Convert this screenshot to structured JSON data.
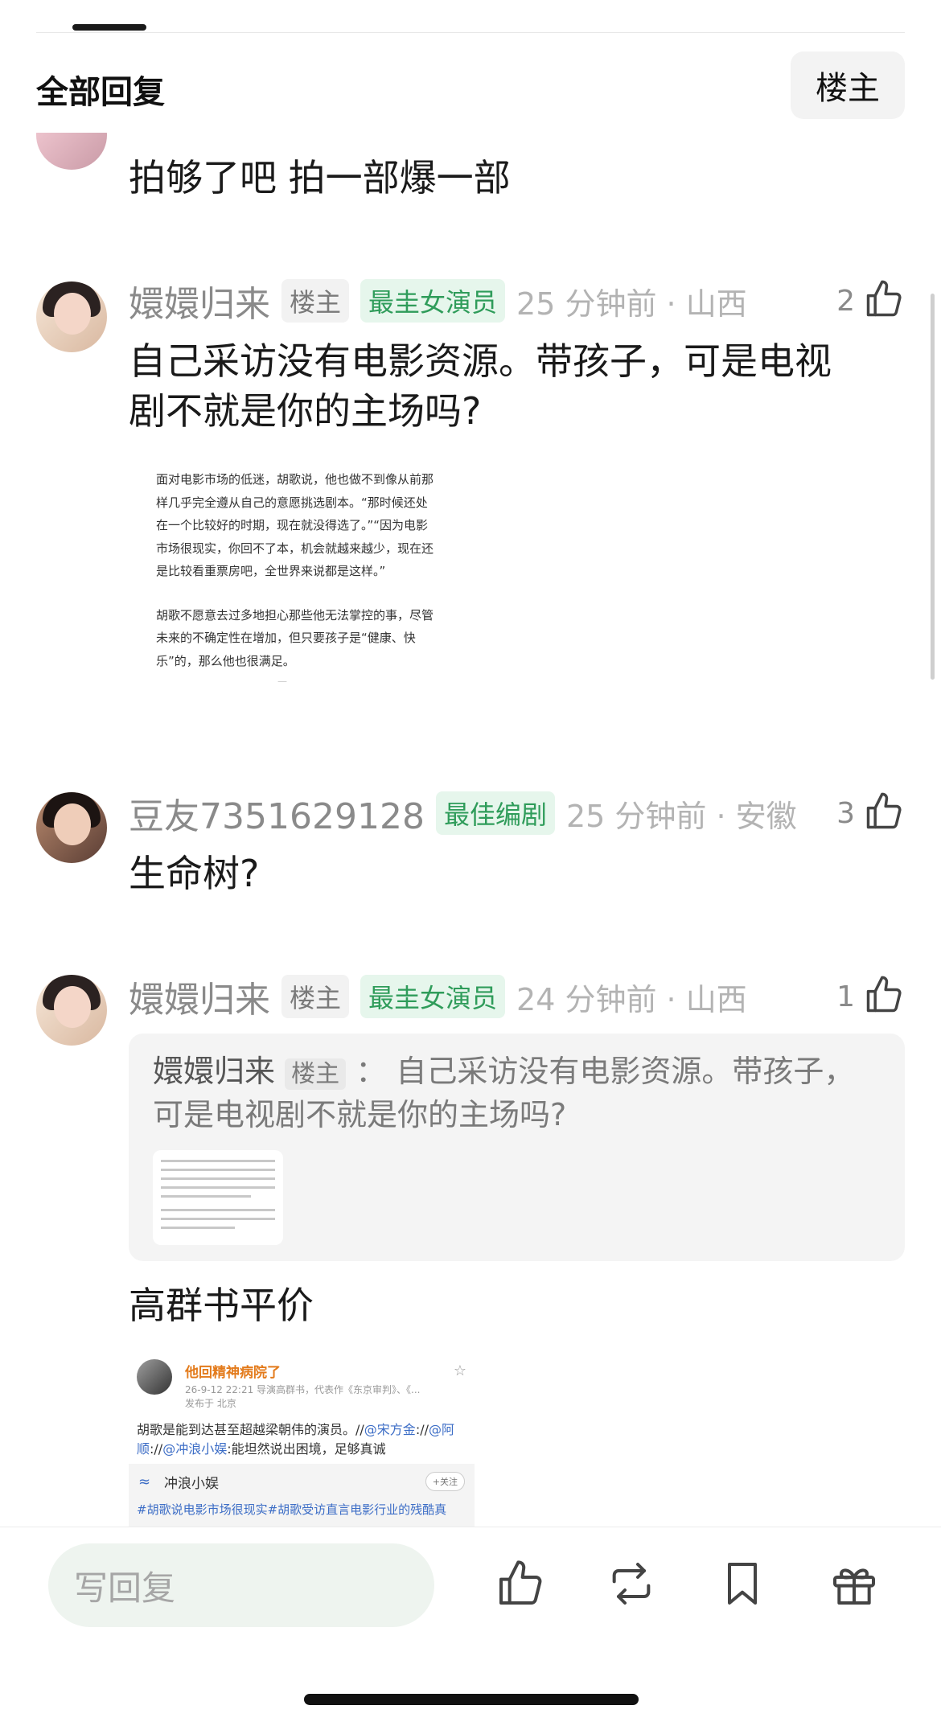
{
  "header": {
    "title": "全部回复",
    "owner_filter_label": "楼主"
  },
  "comments": [
    {
      "text": "拍够了吧 拍一部爆一部"
    },
    {
      "username": "嬛嬛归来",
      "owner_badge": "楼主",
      "award_badge": "最圭女演员",
      "time_location": "25 分钟前 · 山西",
      "likes": "2",
      "text_line1": "自己采访没有电影资源。带孩子，可是电视",
      "text_line2": "剧不就是你的主场吗?",
      "image_text": {
        "p1": "面对电影市场的低迷，胡歌说，他也做不到像从前那样几乎完全遵从自己的意愿挑选剧本。“那时候还处在一个比较好的时期，现在就没得选了。”“因为电影市场很现实，你回不了本，机会就越来越少，现在还是比较看重票房吧，全世界来说都是这样。”",
        "p2": "胡歌不愿意去过多地担心那些他无法掌控的事，尽管未来的不确定性在增加，但只要孩子是“健康、快乐”的，那么他也很满足。"
      }
    },
    {
      "username": "豆友7351629128",
      "award_badge": "最佳编剧",
      "time_location": "25 分钟前 · 安徽",
      "likes": "3",
      "text": "生命树?"
    },
    {
      "username": "嬛嬛归来",
      "owner_badge": "楼主",
      "award_badge": "最圭女演员",
      "time_location": "24 分钟前 · 山西",
      "likes": "1",
      "quote": {
        "name": "嬛嬛归来",
        "badge": "楼主",
        "separator": "：",
        "text": "自己采访没有电影资源。带孩子，可是电视剧不就是你的主场吗?"
      },
      "text": "高群书平价",
      "repost": {
        "name": "他回精神病院了",
        "sub": "26-9-12 22:21  导演高群书，代表作《东京审判》、《...",
        "location": "发布于 北京",
        "body_prefix": "胡歌是能到达甚至超越梁朝伟的演员。//",
        "at1": "@宋方金",
        "sep1": "://",
        "at2": "@阿顺",
        "sep2": "://",
        "at3": "@冲浪小娱",
        "body_suffix": ":能坦然说出困境，足够真诚",
        "inner_name": "冲浪小娱",
        "follow": "+关注",
        "inner_text": "#胡歌说电影市场很现实#胡歌受访直言电影行业的残酷真"
      }
    }
  ],
  "bottom_bar": {
    "reply_placeholder": "写回复"
  },
  "colors": {
    "award_green": "#2f9c5a",
    "award_bg": "#e6f6ec",
    "input_bg": "#eef4ef"
  }
}
